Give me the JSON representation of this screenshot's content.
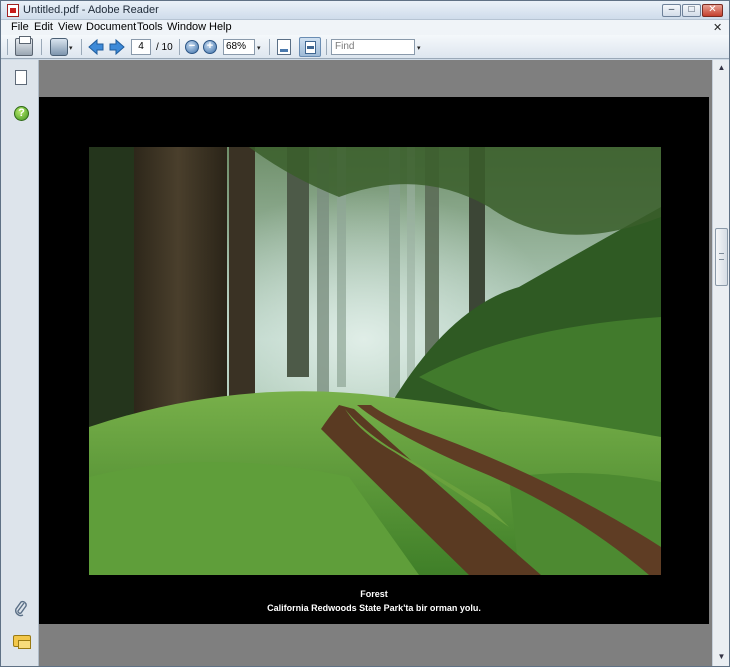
{
  "window": {
    "title": "Untitled.pdf - Adobe Reader",
    "controls": {
      "minimize": "–",
      "maximize": "□",
      "close": "✕"
    }
  },
  "menu": {
    "items": [
      "File",
      "Edit",
      "View",
      "Document",
      "Tools",
      "Window",
      "Help"
    ],
    "close_doc": "✕"
  },
  "toolbar": {
    "icons": [
      "print-icon",
      "hand-tool-icon",
      "previous-page-icon",
      "next-page-icon",
      "zoom-out-icon",
      "zoom-in-icon",
      "fit-page-icon",
      "fit-width-icon"
    ],
    "page_current": "4",
    "page_total": "/ 10",
    "zoom_value": "68%",
    "find_placeholder": "Find",
    "zoom_out_glyph": "−",
    "zoom_in_glyph": "+",
    "dropdown_glyph": "▾"
  },
  "nav_panel": {
    "icons": [
      "pages-icon",
      "help-icon",
      "attachments-icon",
      "comments-icon"
    ],
    "help_glyph": "?",
    "attach_glyph": "🔗"
  },
  "document": {
    "caption_title": "Forest",
    "caption_text": "California Redwoods State Park'ta bir orman yolu."
  },
  "scrollbar": {
    "up_glyph": "▲",
    "down_glyph": "▼",
    "position_fraction": 0.32
  },
  "colors": {
    "page_background": "#000000",
    "workspace_background": "#7f7f7f",
    "caption_text": "#ffffff"
  }
}
